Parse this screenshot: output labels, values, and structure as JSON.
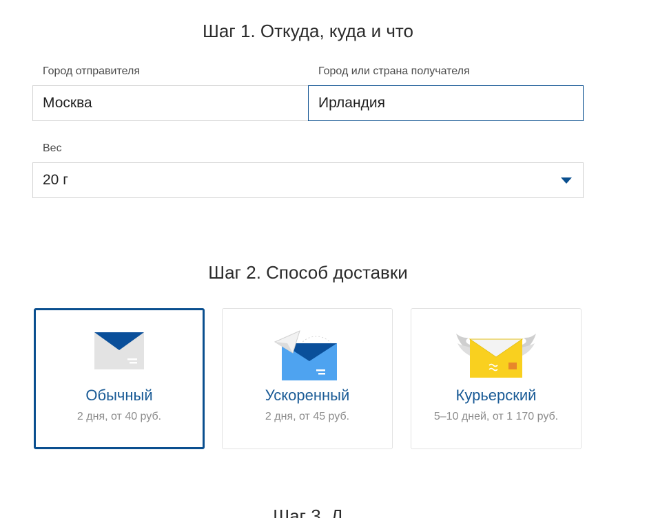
{
  "step1": {
    "title": "Шаг 1. Откуда, куда и что",
    "sender_city": {
      "label": "Город отправителя",
      "value": "Москва"
    },
    "recipient": {
      "label": "Город или страна получателя",
      "value": "Ирландия"
    },
    "weight": {
      "label": "Вес",
      "value": "20 г"
    }
  },
  "step2": {
    "title": "Шаг 2. Способ доставки",
    "options": [
      {
        "title": "Обычный",
        "subtitle": "2 дня, от 40 руб.",
        "icon": "envelope-icon",
        "selected": true
      },
      {
        "title": "Ускоренный",
        "subtitle": "2 дня, от 45 руб.",
        "icon": "paper-plane-envelope-icon",
        "selected": false
      },
      {
        "title": "Курьерский",
        "subtitle": "5–10 дней, от 1 170 руб.",
        "icon": "winged-envelope-icon",
        "selected": false
      }
    ]
  },
  "step3": {
    "title": "Шаг 3. Д"
  },
  "colors": {
    "accent": "#0a4f8f",
    "card_title": "#1a5b96",
    "muted": "#8c8c8c",
    "border": "#d4d4d4"
  }
}
